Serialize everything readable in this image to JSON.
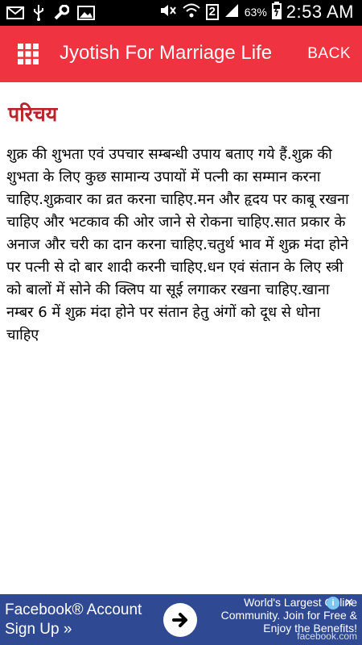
{
  "status_bar": {
    "battery_percent": "63%",
    "time": "2:53 AM",
    "sim_slot": "2",
    "icons": [
      "mail-icon",
      "usb-icon",
      "wrench-icon",
      "image-icon",
      "mute-icon",
      "wifi-icon",
      "sim-2-icon",
      "signal-icon",
      "battery-charging-icon"
    ]
  },
  "app_bar": {
    "title": "Jyotish For Marriage Life",
    "back_label": "BACK",
    "background": "#ef3340",
    "menu_icon": "grid-menu-icon"
  },
  "content": {
    "heading": "परिचय",
    "heading_color": "#b8242b",
    "body": "शुक्र की शुभता एवं उपचार सम्बन्धी उपाय बताए गये हैं.शुक्र की शुभता के लिए कुछ सामान्य उपायों में पत्नी का सम्मान करना चाहिए.शुक्रवार का व्रत करना चाहिए.मन और हृदय पर काबू रखना चाहिए और भटकाव की ओर जाने से रोकना चाहिए.सात प्रकार के अनाज और चरी का दान करना चाहिए.चतुर्थ भाव में शुक्र मंदा होने पर पत्नी से दो बार शादी करनी चाहिए.धन एवं संतान के लिए स्त्री को बालों में सोने की क्लिप या सूई लगाकर रखना चाहिए.खाना नम्बर 6 में शुक्र मंदा होने पर संतान हेतु अंगों को दूध से धोना चाहिए"
  },
  "ad": {
    "left_text": "Facebook® Account Sign Up »",
    "right_text": "World's Largest Online Community. Join for Free & Enjoy the Benefits!",
    "source": "facebook.com",
    "info_label": "i",
    "close_label": "✕",
    "background": "#2f4a93"
  }
}
